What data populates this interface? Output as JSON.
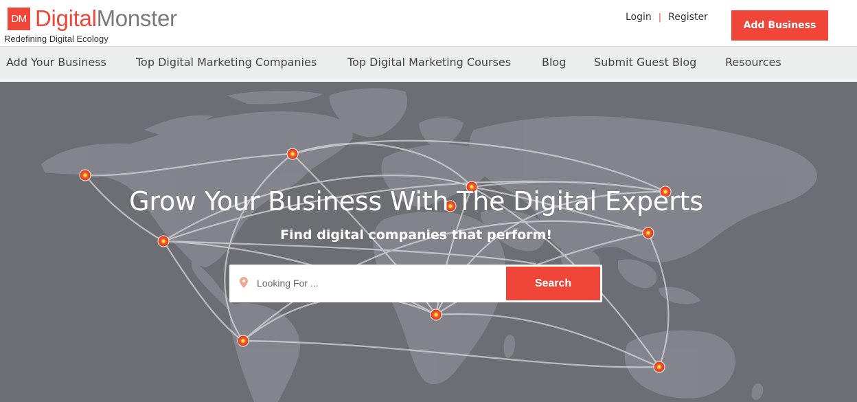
{
  "brand": {
    "mark": "DM",
    "name_part1": "Digital",
    "name_part2": "Monster",
    "tagline": "Redefining Digital Ecology",
    "accent_color": "#f0463a"
  },
  "auth": {
    "login": "Login",
    "separator": "|",
    "register": "Register"
  },
  "header": {
    "add_business": "Add Business"
  },
  "nav": {
    "items": [
      "Add Your Business",
      "Top Digital Marketing Companies",
      "Top Digital Marketing Courses",
      "Blog",
      "Submit Guest Blog",
      "Resources"
    ]
  },
  "hero": {
    "title": "Grow Your Business With The Digital Experts",
    "subtitle": "Find digital companies that perform!",
    "background_color": "#6d6e73",
    "search": {
      "placeholder": "Looking For ...",
      "value": "",
      "button": "Search",
      "icon": "location-pin-icon"
    }
  }
}
